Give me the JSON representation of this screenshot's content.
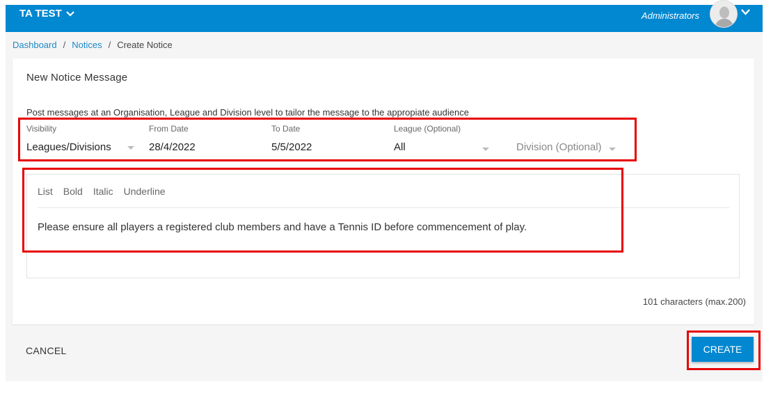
{
  "topbar": {
    "org_name": "TA TEST",
    "role": "Administrators"
  },
  "breadcrumb": {
    "items": [
      "Dashboard",
      "Notices"
    ],
    "current": "Create Notice",
    "separator": "/"
  },
  "form": {
    "title": "New Notice Message",
    "description": "Post messages at an Organisation, League and Division level to tailor the message to the appropiate audience",
    "visibility": {
      "label": "Visibility",
      "value": "Leagues/Divisions"
    },
    "from_date": {
      "label": "From Date",
      "value": "28/4/2022"
    },
    "to_date": {
      "label": "To Date",
      "value": "5/5/2022"
    },
    "league": {
      "label": "League (Optional)",
      "value": "All"
    },
    "division": {
      "placeholder": "Division (Optional)"
    },
    "editor": {
      "toolbar": [
        "List",
        "Bold",
        "Italic",
        "Underline"
      ],
      "content": "Please ensure all players a registered club members and have a Tennis ID before commencement of play."
    },
    "char_count": "101 characters (max.200)"
  },
  "actions": {
    "cancel": "CANCEL",
    "create": "CREATE"
  },
  "colors": {
    "primary": "#0288d1",
    "link": "#1e88c8",
    "highlight": "#e60000",
    "background": "#f5f5f5"
  }
}
